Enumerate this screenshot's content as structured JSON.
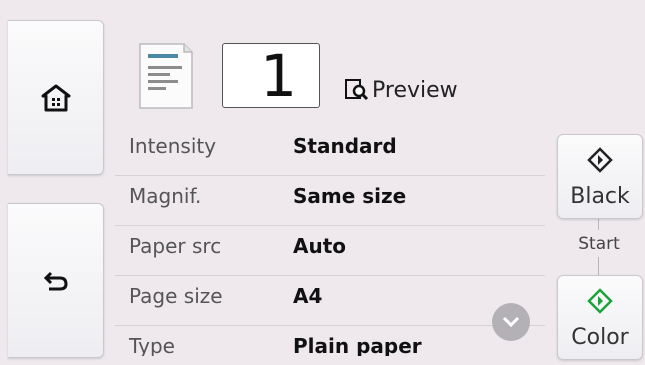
{
  "copies": {
    "value": "1"
  },
  "preview": {
    "label": "Preview"
  },
  "settings": [
    {
      "label": "Intensity",
      "value": "Standard"
    },
    {
      "label": "Magnif.",
      "value": "Same size"
    },
    {
      "label": "Paper src",
      "value": "Auto"
    },
    {
      "label": "Page size",
      "value": "A4"
    },
    {
      "label": "Type",
      "value": "Plain paper"
    }
  ],
  "start": {
    "label": "Start",
    "black_label": "Black",
    "color_label": "Color"
  },
  "icons": {
    "home": "home-icon",
    "back": "back-icon",
    "document": "document-icon",
    "preview": "preview-icon",
    "scroll_down": "chevron-down-icon",
    "start": "start-diamond-icon"
  },
  "colors": {
    "background": "#efe9ee",
    "start_color_accent": "#1aa33a",
    "start_black_accent": "#222222"
  }
}
